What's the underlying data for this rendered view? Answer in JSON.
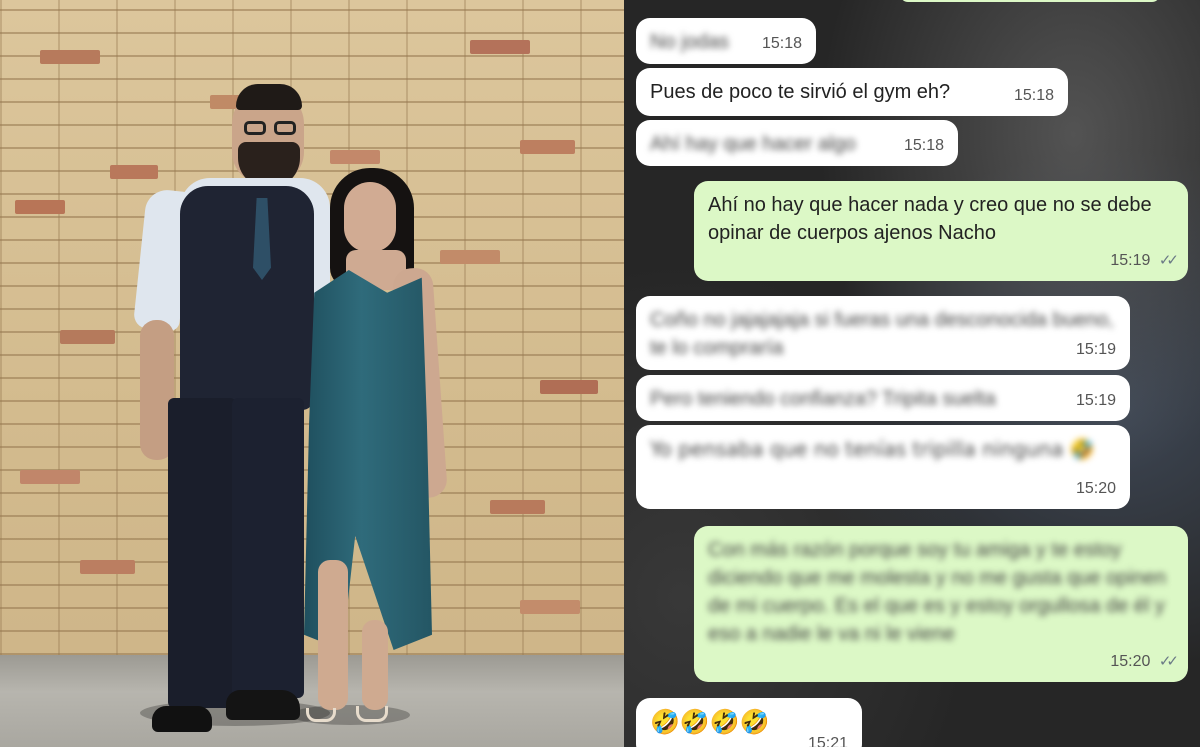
{
  "chat": {
    "messages": [
      {
        "side": "in",
        "text": "No jodas",
        "time": "15:18",
        "blurred": true
      },
      {
        "side": "in",
        "text": "Pues de poco te sirvió el gym eh?",
        "time": "15:18",
        "blurred": false
      },
      {
        "side": "in",
        "text": "Ahí hay que hacer algo",
        "time": "15:18",
        "blurred": true
      },
      {
        "side": "out",
        "text": "Ahí no hay que hacer nada y creo que no se debe opinar de cuerpos ajenos Nacho",
        "time": "15:19",
        "blurred": false
      },
      {
        "side": "in",
        "text": "Coño no jajajajaja si fueras una desconocida bueno, te lo compraría",
        "time": "15:19",
        "blurred": true
      },
      {
        "side": "in",
        "text": "Pero teniendo confianza? Tripita suelta",
        "time": "15:19",
        "blurred": true
      },
      {
        "side": "in",
        "text": "Yo pensaba que no tenías tripilla ninguna 🤣",
        "time": "15:20",
        "blurred": true
      },
      {
        "side": "out",
        "text": "Con más razón porque soy tu amiga y te estoy diciendo que me molesta y no me gusta que opinen de mi cuerpo. Es el que es y estoy orgullosa de él y eso a nadie le va ni le viene",
        "time": "15:20",
        "blurred": true
      },
      {
        "side": "in",
        "text": "🤣🤣🤣🤣",
        "time": "15:21",
        "blurred": false
      }
    ],
    "read_ticks": "✓✓"
  },
  "colors": {
    "incoming_bubble": "#ffffff",
    "outgoing_bubble": "#dcf8c6",
    "chat_background": "#262626",
    "brick_wall": "#d8c296"
  },
  "icons": [
    "double-check-icon",
    "rolling-laughing-emoji"
  ]
}
